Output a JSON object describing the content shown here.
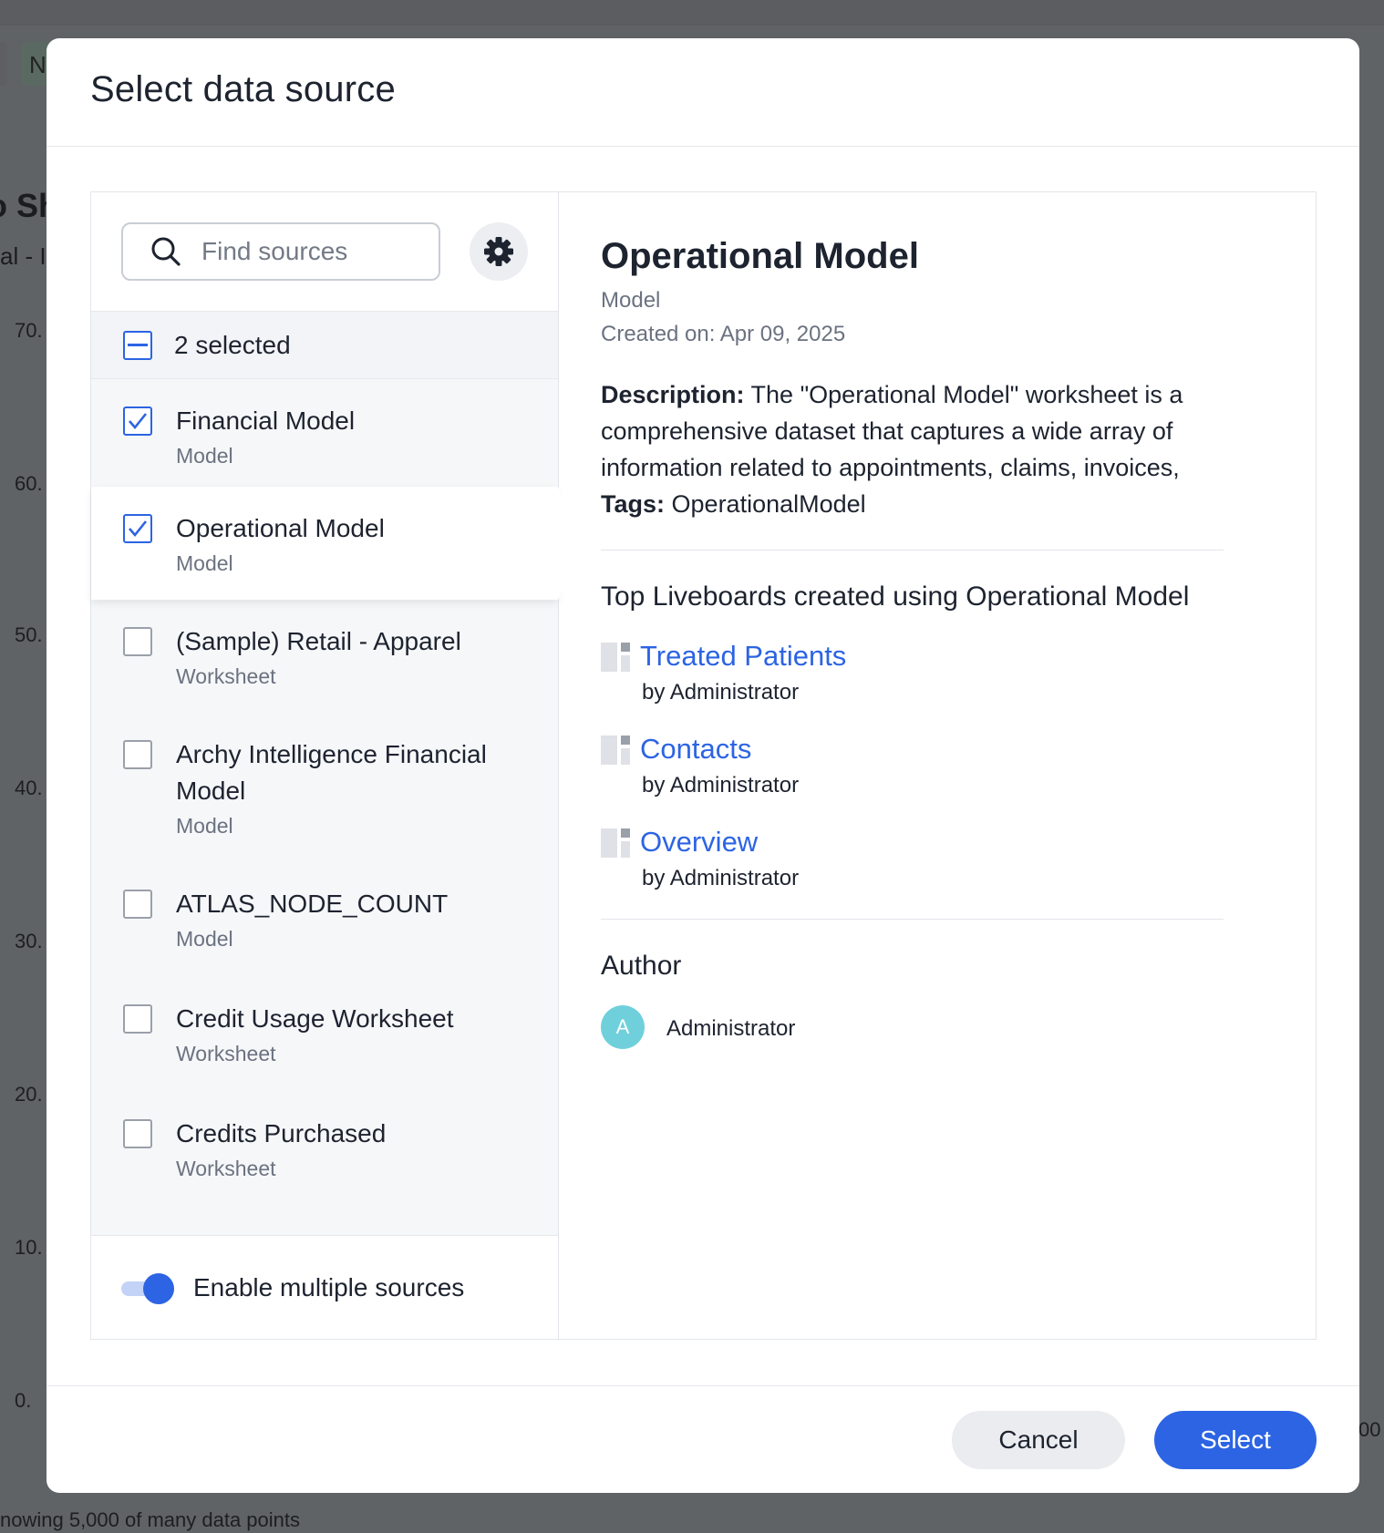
{
  "background": {
    "pill_letter": "N",
    "title_fragment": "o Sh",
    "subtitle_fragment": "al - I",
    "y_ticks": [
      "70.",
      "60.",
      "50.",
      "40.",
      "30.",
      "20.",
      "10.",
      "0."
    ],
    "right_fragment": "00",
    "footer_text": "nowing 5,000 of many data points"
  },
  "modal": {
    "title": "Select data source"
  },
  "search": {
    "placeholder": "Find sources",
    "value": ""
  },
  "selection": {
    "label": "2 selected"
  },
  "sources": [
    {
      "name": "Financial Model",
      "type": "Model",
      "checked": true
    },
    {
      "name": "Operational Model",
      "type": "Model",
      "checked": true,
      "active": true
    },
    {
      "name": "(Sample) Retail - Apparel",
      "type": "Worksheet",
      "checked": false
    },
    {
      "name": "Archy Intelligence Financial Model",
      "type": "Model",
      "checked": false
    },
    {
      "name": "ATLAS_NODE_COUNT",
      "type": "Model",
      "checked": false
    },
    {
      "name": "Credit Usage Worksheet",
      "type": "Worksheet",
      "checked": false
    },
    {
      "name": "Credits Purchased",
      "type": "Worksheet",
      "checked": false
    }
  ],
  "toggle": {
    "label": "Enable multiple sources",
    "enabled": true
  },
  "detail": {
    "title": "Operational Model",
    "type": "Model",
    "created": "Created on: Apr 09, 2025",
    "description_label": "Description:",
    "description": "The \"Operational Model\" worksheet is a comprehensive dataset that captures a wide array of information related to appointments, claims, invoices,",
    "tags_label": "Tags:",
    "tags": "OperationalModel",
    "liveboards_title": "Top Liveboards created using Operational Model",
    "liveboards": [
      {
        "name": "Treated Patients",
        "by": "by Administrator"
      },
      {
        "name": "Contacts",
        "by": "by Administrator"
      },
      {
        "name": "Overview",
        "by": "by Administrator"
      }
    ],
    "author_title": "Author",
    "author": {
      "initial": "A",
      "name": "Administrator"
    }
  },
  "footer": {
    "cancel_label": "Cancel",
    "select_label": "Select"
  },
  "colors": {
    "accent": "#2c64e3",
    "avatar": "#6fd0db"
  }
}
